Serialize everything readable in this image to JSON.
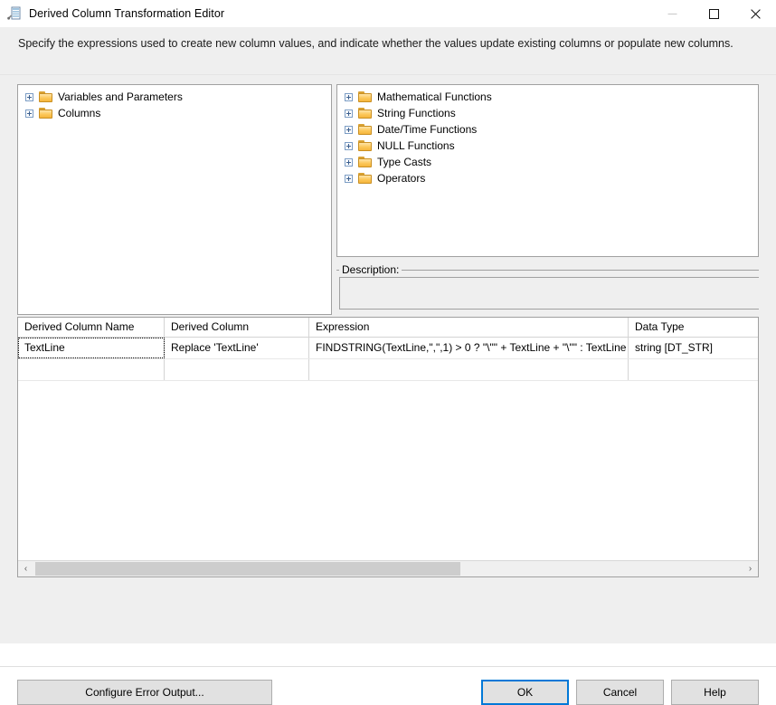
{
  "window": {
    "title": "Derived Column Transformation Editor",
    "icon": "derived-column-editor-icon",
    "caption": {
      "minimize": "—",
      "maximize": "□",
      "close": "✕"
    }
  },
  "header": {
    "instruction": "Specify the expressions used to create new column values, and indicate whether the values update existing columns or populate new columns."
  },
  "variables_tree": {
    "nodes": [
      {
        "label": "Variables and Parameters",
        "expander": "plus",
        "icon": "folder-icon"
      },
      {
        "label": "Columns",
        "expander": "plus",
        "icon": "folder-icon"
      }
    ]
  },
  "functions_tree": {
    "nodes": [
      {
        "label": "Mathematical Functions",
        "expander": "plus",
        "icon": "folder-icon"
      },
      {
        "label": "String Functions",
        "expander": "plus",
        "icon": "folder-icon"
      },
      {
        "label": "Date/Time Functions",
        "expander": "plus",
        "icon": "folder-icon"
      },
      {
        "label": "NULL Functions",
        "expander": "plus",
        "icon": "folder-icon"
      },
      {
        "label": "Type Casts",
        "expander": "plus",
        "icon": "folder-icon"
      },
      {
        "label": "Operators",
        "expander": "plus",
        "icon": "folder-icon"
      }
    ]
  },
  "description": {
    "legend": "Description:",
    "text": ""
  },
  "grid": {
    "columns": [
      "Derived Column Name",
      "Derived Column",
      "Expression",
      "Data Type"
    ],
    "rows": [
      {
        "derived_column_name": "TextLine",
        "derived_column": "Replace 'TextLine'",
        "expression": "FINDSTRING(TextLine,\",\",1) > 0 ? \"\\\"\" + TextLine + \"\\\"\" : TextLine",
        "data_type": "string [DT_STR]"
      },
      {
        "derived_column_name": "",
        "derived_column": "",
        "expression": "",
        "data_type": ""
      }
    ],
    "scrollbar": {
      "left_arrow": "‹",
      "right_arrow": "›"
    }
  },
  "footer": {
    "configure_error_output": "Configure Error Output...",
    "ok": "OK",
    "cancel": "Cancel",
    "help": "Help"
  },
  "colors": {
    "accent_focus": "#0078d7",
    "dialog_background": "#efefef",
    "panel_background": "#ffffff",
    "border": "#a0a0a0",
    "folder": "#fcc759"
  }
}
